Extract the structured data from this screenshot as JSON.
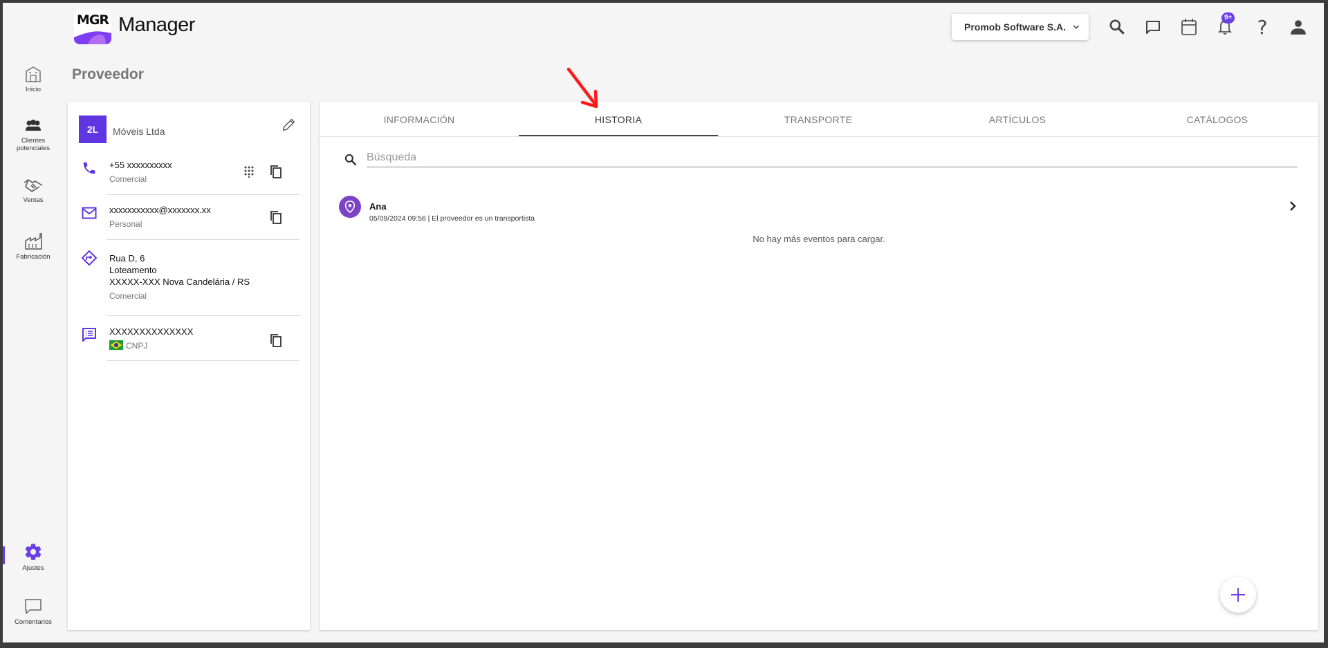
{
  "app": {
    "logo_text": "MGR",
    "title": "Manager"
  },
  "header": {
    "company": "Promob Software S.A.",
    "notifications_badge": "9+",
    "icons": [
      "search-icon",
      "chat-icon",
      "calendar-icon",
      "bell-icon",
      "help-icon",
      "account-icon"
    ]
  },
  "nav": {
    "items": [
      {
        "label": "Inicio",
        "icon": "building-icon"
      },
      {
        "label": "Clientes potenciales",
        "icon": "people-icon"
      },
      {
        "label": "Ventas",
        "icon": "handshake-icon"
      },
      {
        "label": "Fabricación",
        "icon": "factory-icon"
      },
      {
        "label": "Ajustes",
        "icon": "gear-icon",
        "active": true
      },
      {
        "label": "Comentarios",
        "icon": "comment-icon"
      }
    ]
  },
  "page": {
    "title": "Proveedor"
  },
  "supplier": {
    "initials": "2L",
    "name": "Móveis Ltda",
    "phone": {
      "value": "+55 xxxxxxxxxx",
      "type": "Comercial"
    },
    "email": {
      "value": "xxxxxxxxxxx@xxxxxxx.xx",
      "type": "Personal"
    },
    "address": {
      "line1": "Rua D, 6",
      "line2": "Loteamento",
      "line3": "XXXXX-XXX Nova Candelária / RS",
      "type": "Comercial"
    },
    "document": {
      "value": "XXXXXXXXXXXXXX",
      "type": "CNPJ"
    }
  },
  "tabs": [
    "INFORMACIÓN",
    "HISTORIA",
    "TRANSPORTE",
    "ARTÍCULOS",
    "CATÁLOGOS"
  ],
  "active_tab": "HISTORIA",
  "search": {
    "placeholder": "Búsqueda",
    "value": ""
  },
  "events": [
    {
      "user": "Ana",
      "meta": "05/09/2024 09:56 | El proveedor es un transportista"
    }
  ],
  "no_more_text": "No hay más eventos para cargar.",
  "colors": {
    "accent": "#6b3fe6",
    "event_pin": "#7c43c7",
    "annotation_arrow": "#ff1a1a"
  }
}
